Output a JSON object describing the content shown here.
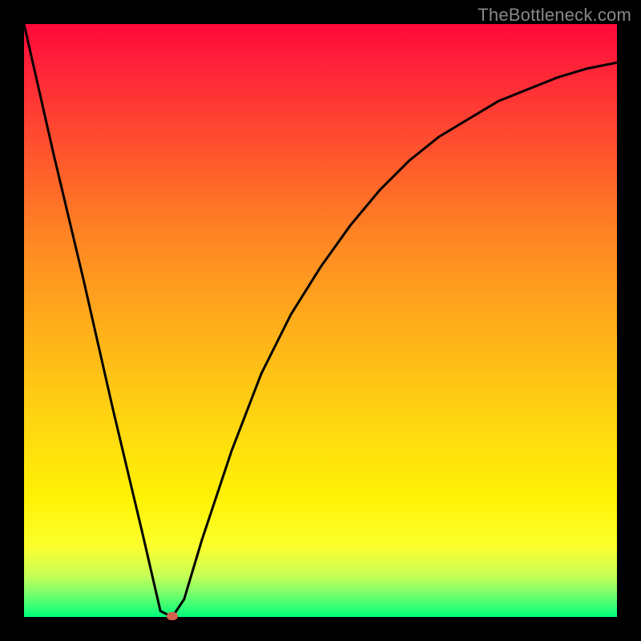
{
  "watermark": "TheBottleneck.com",
  "colors": {
    "frame_bg": "#000000",
    "curve_stroke": "#000000",
    "marker_fill": "#d4614e",
    "gradient_stops": [
      "#ff083a",
      "#ff1b3a",
      "#ff4f2f",
      "#ff8224",
      "#ffb11a",
      "#ffd810",
      "#fff205",
      "#fcff2c",
      "#c7ff55",
      "#7aff6c",
      "#00ff7a"
    ]
  },
  "chart_data": {
    "type": "line",
    "title": "",
    "xlabel": "",
    "ylabel": "",
    "xlim": [
      0,
      100
    ],
    "ylim": [
      0,
      100
    ],
    "x": [
      0,
      5,
      10,
      15,
      20,
      23,
      25,
      27,
      30,
      35,
      40,
      45,
      50,
      55,
      60,
      65,
      70,
      75,
      80,
      85,
      90,
      95,
      100
    ],
    "values": [
      100,
      78,
      57,
      35,
      14,
      1,
      0,
      3,
      13,
      28,
      41,
      51,
      59,
      66,
      72,
      77,
      81,
      84,
      87,
      89,
      91,
      92.5,
      93.5
    ],
    "marker": {
      "x": 25,
      "y": 0
    }
  }
}
